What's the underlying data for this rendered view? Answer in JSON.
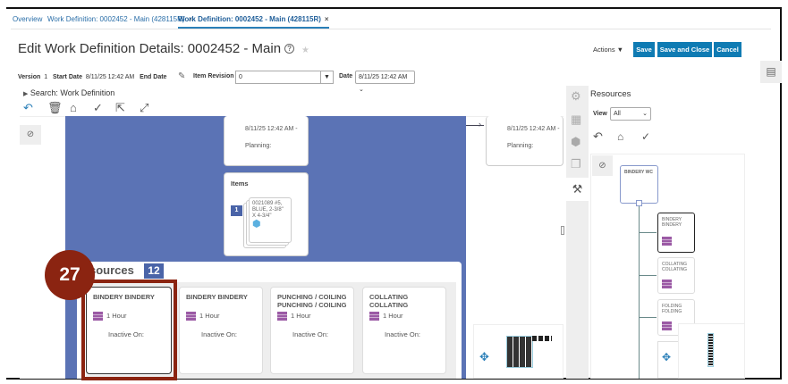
{
  "tabs": [
    {
      "label": "Overview"
    },
    {
      "label": "Work Definition: 0002452 - Main (428115R)",
      "close": "×"
    },
    {
      "label": "Work Definition: 0002452 - Main (428115R)",
      "close": "×",
      "active": true
    }
  ],
  "header": {
    "title": "Edit Work Definition Details: 0002452 - Main",
    "help": "?",
    "star": "★",
    "actions": "Actions ▼",
    "save": "Save",
    "save_close": "Save and Close",
    "cancel": "Cancel"
  },
  "fields": {
    "version_label": "Version",
    "version": "1",
    "start_label": "Start Date",
    "start": "8/11/25 12:42 AM",
    "end_label": "End Date",
    "item_rev_label": "Item Revision",
    "item_rev": "0",
    "date_label": "Date",
    "date": "8/11/25 12:42 AM"
  },
  "search": {
    "label": "Search: Work Definition"
  },
  "canvas": {
    "op_card": {
      "date": "8/11/25 12:42 AM -",
      "planning": "Planning:"
    },
    "items": {
      "title": "Items",
      "count": "1",
      "item": "0021089 #5, BLUE, 2-3/8\" X 4-3/4\""
    },
    "resources": {
      "title": "sources",
      "count": "12",
      "cards": [
        {
          "name": "BINDERY BINDERY",
          "duration": "1 Hour",
          "inactive": "Inactive On:"
        },
        {
          "name": "BINDERY BINDERY",
          "duration": "1 Hour",
          "inactive": "Inactive On:"
        },
        {
          "name": "PUNCHING / COILING PUNCHING / COILING",
          "duration": "1 Hour",
          "inactive": "Inactive On:"
        },
        {
          "name": "COLLATING COLLATING",
          "duration": "1 Hour",
          "inactive": "Inactive On:"
        }
      ]
    }
  },
  "step_badge": "27",
  "panel": {
    "title": "Resources",
    "view_label": "View",
    "view": "All",
    "root": "BINDERY WC",
    "nodes": [
      "BINDERY BINDERY",
      "COLLATING COLLATING",
      "FOLDING FOLDING"
    ]
  },
  "colors": {
    "accent": "#0f7bb3",
    "canvas": "#5b73b5",
    "badge": "#8b2411"
  }
}
